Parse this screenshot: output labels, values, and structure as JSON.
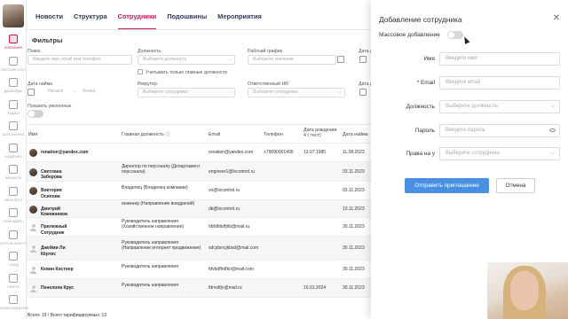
{
  "nav": {
    "items": [
      {
        "label": "КОМПАНИЯ",
        "icon": "company-icon",
        "active": true
      },
      {
        "label": "РАБОЧИЙ СТОЛ",
        "icon": "desk-icon"
      },
      {
        "label": "ДАШБОРДЫ",
        "icon": "dashboard-icon"
      },
      {
        "label": "ЗАДАЧИ",
        "icon": "tasks-icon"
      },
      {
        "label": "БАЗА ЗНАНИЙ",
        "icon": "knowledge-icon"
      },
      {
        "label": "АКАДЕМИЯ",
        "icon": "academy-icon"
      },
      {
        "label": "ФИНАНСЫ",
        "icon": "finance-icon"
      },
      {
        "label": "ФИНОЛОГИ",
        "icon": "finologi-icon"
      },
      {
        "label": "КАЛЕНДАРЬ",
        "icon": "calendar-icon"
      },
      {
        "label": "КОНТРОЛЬ КАЧЕСТВА",
        "icon": "quality-icon"
      },
      {
        "label": "СКЛАД",
        "icon": "warehouse-icon"
      },
      {
        "label": "ТИКЕТЫ",
        "icon": "tickets-icon"
      },
      {
        "label": "ВОЗНАГРАЖДЕНИЯ",
        "icon": "rewards-icon"
      }
    ]
  },
  "tabs": [
    {
      "label": "Новости",
      "active": false
    },
    {
      "label": "Структура",
      "active": false
    },
    {
      "label": "Сотрудники",
      "active": true
    },
    {
      "label": "Подошвины",
      "active": false
    },
    {
      "label": "Мероприятия",
      "active": false
    }
  ],
  "filters": {
    "title": "Фильтры",
    "search": {
      "label": "Поиск",
      "placeholder": "Введите имя, email или телефон"
    },
    "position": {
      "label": "Должность",
      "placeholder": "Выберите должность"
    },
    "main_only": {
      "label": "Учитывать только главные должности"
    },
    "schedule": {
      "label": "Рабочий график",
      "placeholder": "Выберите значение"
    },
    "birth": {
      "label": "Дата д"
    },
    "hire_date": {
      "label": "Дата найма",
      "from": "Начало",
      "to": "Конец"
    },
    "recruiter": {
      "label": "Рекрутер",
      "placeholder": "Выберите сотрудника"
    },
    "responsible_hr": {
      "label": "Ответственный HR",
      "placeholder": "Выберите сотрудника"
    },
    "date2": {
      "label": "Дата д"
    },
    "show_fired": {
      "label": "Показать уволенных"
    }
  },
  "table": {
    "columns": [
      "Имя",
      "Главная должность",
      "Email",
      "Телефон",
      "Дата рождения",
      "Дата найма"
    ],
    "birth_sub": "4 ( тест)",
    "rows": [
      {
        "name": "renation@yandex.com",
        "position": "",
        "email": "renation@yandex.com",
        "phone": "+79090001405",
        "birth": "13.07.1985",
        "hire": "11.08.2023",
        "avatar": "photo"
      },
      {
        "name": "Светлана Заберова",
        "position": "Директор по персоналу (Департамент персонала)",
        "email": "engineer1@locontrol.ru",
        "phone": "",
        "birth": "",
        "hire": "03.11.2023",
        "avatar": "photo"
      },
      {
        "name": "Виктория Осипова",
        "position": "Владелец (Владелец компании)",
        "email": "vo@locontrol.ru",
        "phone": "",
        "birth": "",
        "hire": "03.11.2023",
        "avatar": "photo"
      },
      {
        "name": "Дмитрий Кожевников",
        "position": "инженер (Направление внедрений)",
        "email": "dk@locontrol.ru",
        "phone": "",
        "birth": "",
        "hire": "13.11.2023",
        "avatar": "photo"
      },
      {
        "name": "Прилежный Сотрудник",
        "position": "Руководитель направления (Хозяйственное направление)",
        "email": "hbfdhbdfjhb@mail.ru",
        "phone": "",
        "birth": "",
        "hire": "30.11.2023",
        "avatar": "person"
      },
      {
        "name": "Джейми Ли Кёртис",
        "position": "Руководитель направления (Направление интернет продвижения)",
        "email": "sdcjdsncjkbsd@mail.com",
        "phone": "",
        "birth": "",
        "hire": "30.11.2023",
        "avatar": "person"
      },
      {
        "name": "Кевин Костнер",
        "position": "Руководитель направления",
        "email": "fdvbdfhdfkn@mail.com",
        "phone": "",
        "birth": "",
        "hire": "30.11.2023",
        "avatar": "person"
      },
      {
        "name": "Пенелопа Крус",
        "position": "Руководитель направления",
        "email": "fdnvdfjn@mail.ru",
        "phone": "",
        "birth": "16.01.2024",
        "hire": "30.11.2023",
        "avatar": "person"
      }
    ],
    "footer": "Всего: 19 / Всего тарифицируемых: 13"
  },
  "panel": {
    "title": "Добавление сотрудника",
    "mass_add_label": "Массовое добавление",
    "fields": [
      {
        "label": "Имя",
        "placeholder": "Введите имя",
        "type": "text"
      },
      {
        "label": "* Email",
        "placeholder": "Введите email",
        "type": "text"
      },
      {
        "label": "Должность",
        "placeholder": "Выберите должность",
        "type": "select"
      },
      {
        "label": "Пароль",
        "placeholder": "Введите пароль",
        "type": "password"
      },
      {
        "label": "Права на у",
        "placeholder": "Выберите сотрудника",
        "type": "select"
      }
    ],
    "send_label": "Отправить приглашение",
    "cancel_label": "Отмена"
  }
}
